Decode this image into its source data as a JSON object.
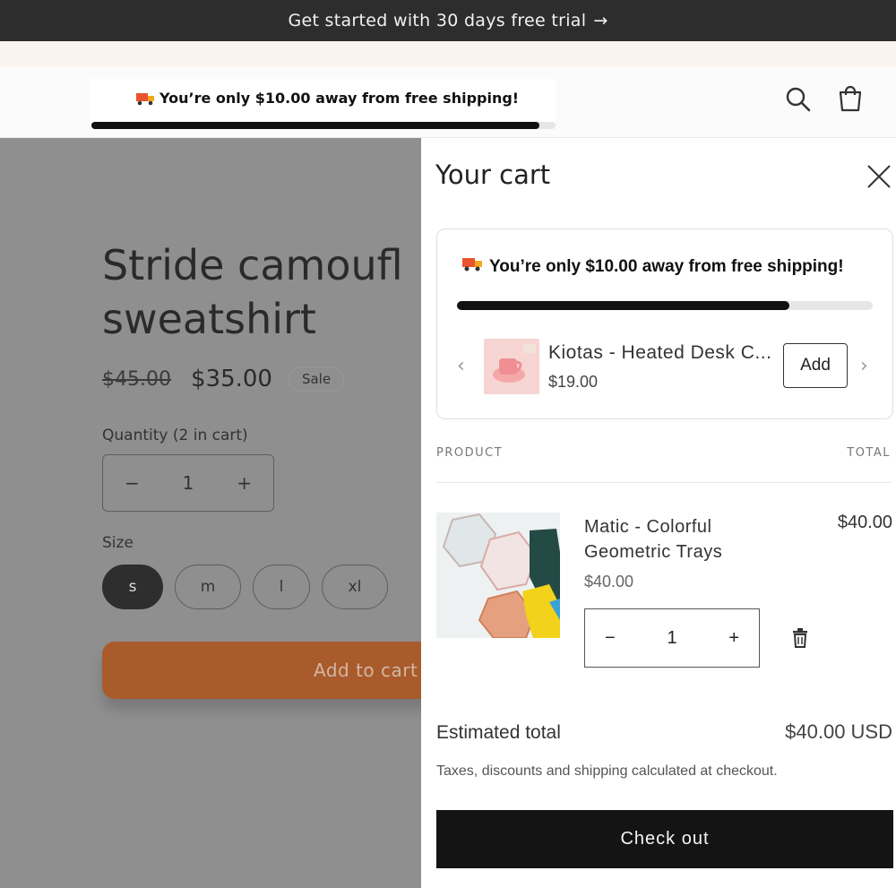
{
  "announcement": {
    "text": "Get started with 30 days free trial",
    "arrow": "→"
  },
  "header": {
    "shipping_message": "You’re only $10.00 away from free shipping!",
    "shipping_progress": 0.965,
    "icons": [
      "search-icon",
      "cart-icon",
      "truck-icon"
    ]
  },
  "product": {
    "title_line1": "Stride camoufl",
    "title_line2": "sweatshirt",
    "price_old": "$45.00",
    "price_new": "$35.00",
    "sale_badge": "Sale",
    "quantity_label": "Quantity (2 in cart)",
    "quantity": "1",
    "minus": "−",
    "plus": "+",
    "size_label": "Size",
    "sizes": [
      "s",
      "m",
      "l",
      "xl"
    ],
    "selected_size": "s",
    "add_to_cart": "Add to cart"
  },
  "cart": {
    "title": "Your cart",
    "shipping_message": "You’re only $10.00 away from free shipping!",
    "shipping_progress": 0.8,
    "upsell": {
      "name": "Kiotas - Heated Desk C...",
      "price": "$19.00",
      "add_label": "Add",
      "prev": "‹",
      "next": "›"
    },
    "columns": {
      "product": "PRODUCT",
      "total": "TOTAL"
    },
    "item": {
      "name": "Matic - Colorful Geometric Trays",
      "unit_price": "$40.00",
      "line_total": "$40.00",
      "quantity": "1",
      "minus": "−",
      "plus": "+"
    },
    "estimated_total_label": "Estimated total",
    "estimated_total_value": "$40.00 USD",
    "tax_note": "Taxes, discounts and shipping calculated at checkout.",
    "checkout_label": "Check out"
  },
  "colors": {
    "announcement_bg": "#2d2d2d",
    "overlay": "#8f8f8f",
    "add_to_cart": "#a95b2c",
    "checkout_bg": "#141414"
  }
}
